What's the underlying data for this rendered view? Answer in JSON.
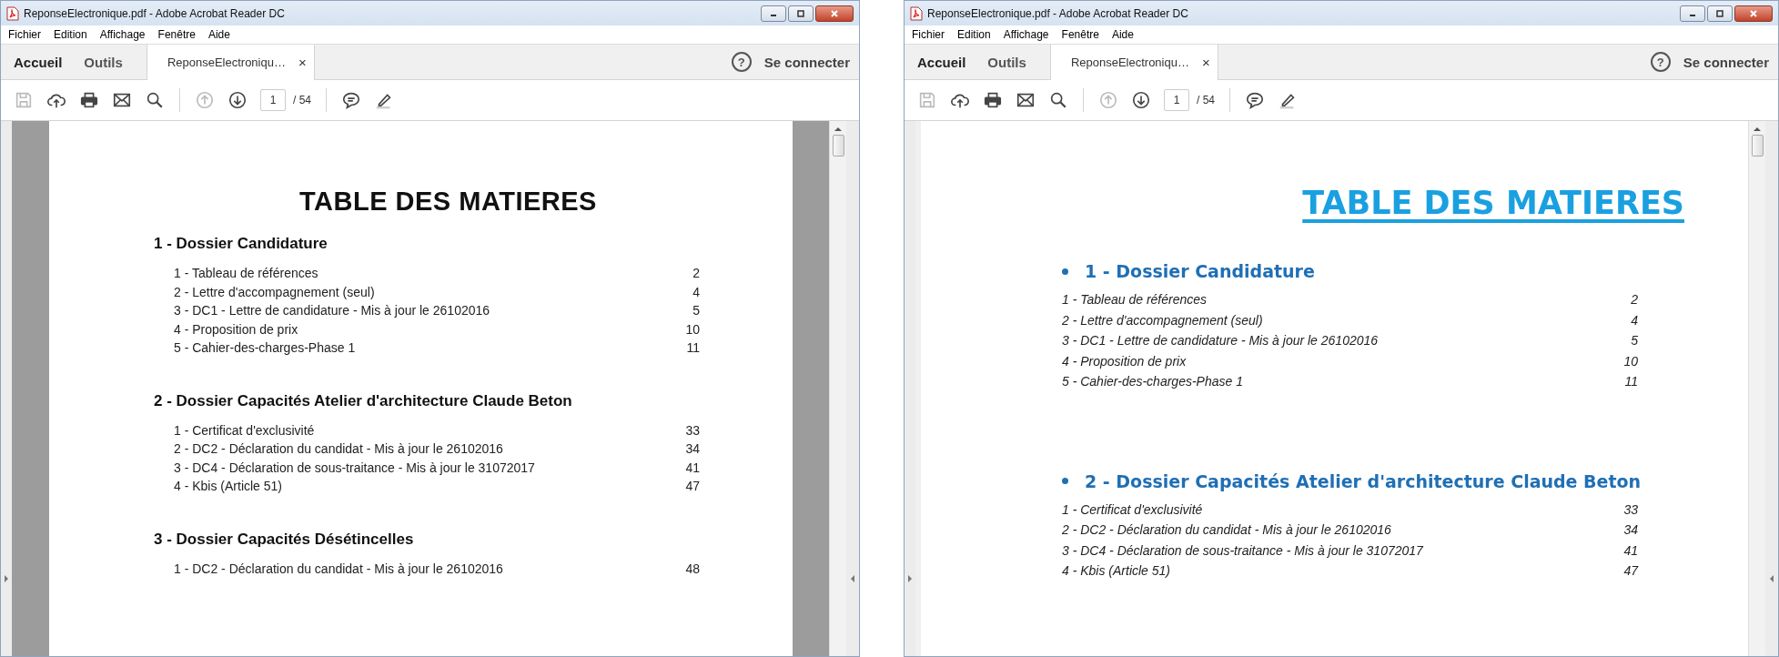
{
  "windows": [
    {
      "title": "ReponseElectronique.pdf - Adobe Acrobat Reader DC",
      "menu": [
        "Fichier",
        "Edition",
        "Affichage",
        "Fenêtre",
        "Aide"
      ],
      "nav": [
        "Accueil",
        "Outils"
      ],
      "doc_tab": {
        "label": "ReponseElectroniqu…",
        "close": "×"
      },
      "help": "?",
      "sign_in": "Se connecter",
      "tools": [
        {
          "kind": "save",
          "disabled": true
        },
        {
          "kind": "upload",
          "disabled": false
        },
        {
          "kind": "print",
          "disabled": false
        },
        {
          "kind": "mail",
          "disabled": false
        },
        {
          "kind": "search",
          "disabled": false
        },
        {
          "kind": "sep"
        },
        {
          "kind": "up",
          "disabled": true
        },
        {
          "kind": "down",
          "disabled": false
        },
        {
          "kind": "page"
        },
        {
          "kind": "sep"
        },
        {
          "kind": "comment",
          "disabled": false
        },
        {
          "kind": "pen",
          "disabled": false
        }
      ],
      "page_number": "1",
      "page_total": "/ 54",
      "document": {
        "kind": "plain",
        "title": "TABLE DES MATIERES",
        "sections": [
          {
            "heading": "1 - Dossier Candidature",
            "entries": [
              {
                "label": "1 - Tableau de références",
                "page": "2"
              },
              {
                "label": "2 - Lettre d'accompagnement (seul)",
                "page": "4"
              },
              {
                "label": "3 - DC1 - Lettre de candidature - Mis à jour le 26102016",
                "page": "5"
              },
              {
                "label": "4 - Proposition de prix",
                "page": "10"
              },
              {
                "label": "5 - Cahier-des-charges-Phase 1",
                "page": "11"
              }
            ]
          },
          {
            "heading": "2 - Dossier Capacités Atelier d'architecture Claude Beton",
            "entries": [
              {
                "label": "1 - Certificat d'exclusivité",
                "page": "33"
              },
              {
                "label": "2 - DC2 - Déclaration du candidat - Mis à jour le 26102016",
                "page": "34"
              },
              {
                "label": "3 - DC4 - Déclaration de sous-traitance - Mis à jour le 31072017",
                "page": "41"
              },
              {
                "label": "4 - Kbis (Article 51)",
                "page": "47"
              }
            ]
          },
          {
            "heading": "3 - Dossier Capacités Désétincelles",
            "entries": [
              {
                "label": "1 - DC2 - Déclaration du candidat - Mis à jour le 26102016",
                "page": "48"
              }
            ]
          }
        ]
      }
    },
    {
      "title": "ReponseElectronique.pdf - Adobe Acrobat Reader DC",
      "menu": [
        "Fichier",
        "Edition",
        "Affichage",
        "Fenêtre",
        "Aide"
      ],
      "nav": [
        "Accueil",
        "Outils"
      ],
      "doc_tab": {
        "label": "ReponseElectroniqu…",
        "close": "×"
      },
      "help": "?",
      "sign_in": "Se connecter",
      "tools": [
        {
          "kind": "save",
          "disabled": true
        },
        {
          "kind": "upload",
          "disabled": false
        },
        {
          "kind": "print",
          "disabled": false
        },
        {
          "kind": "mail",
          "disabled": false
        },
        {
          "kind": "search",
          "disabled": false
        },
        {
          "kind": "sep"
        },
        {
          "kind": "up",
          "disabled": true
        },
        {
          "kind": "down",
          "disabled": false
        },
        {
          "kind": "page"
        },
        {
          "kind": "sep"
        },
        {
          "kind": "comment",
          "disabled": false
        },
        {
          "kind": "pen",
          "disabled": false
        }
      ],
      "page_number": "1",
      "page_total": "/ 54",
      "document": {
        "kind": "formatted",
        "title": "TABLE DES MATIERES",
        "sections": [
          {
            "heading": "1 - Dossier Candidature",
            "entries": [
              {
                "label": "1 - Tableau de références",
                "page": "2"
              },
              {
                "label": "2 - Lettre d'accompagnement (seul)",
                "page": "4"
              },
              {
                "label": "3 - DC1 - Lettre de candidature - Mis à jour le 26102016",
                "page": "5"
              },
              {
                "label": "4 - Proposition de prix",
                "page": "10"
              },
              {
                "label": "5 - Cahier-des-charges-Phase 1",
                "page": "11"
              }
            ]
          },
          {
            "heading": "2 - Dossier Capacités Atelier d'architecture Claude Beton",
            "entries": [
              {
                "label": "1 - Certificat d'exclusivité",
                "page": "33"
              },
              {
                "label": "2 - DC2 - Déclaration du candidat - Mis à jour le 26102016",
                "page": "34"
              },
              {
                "label": "3 - DC4 - Déclaration de sous-traitance - Mis à jour le 31072017",
                "page": "41"
              },
              {
                "label": "4 - Kbis (Article 51)",
                "page": "47"
              }
            ]
          }
        ]
      }
    }
  ]
}
